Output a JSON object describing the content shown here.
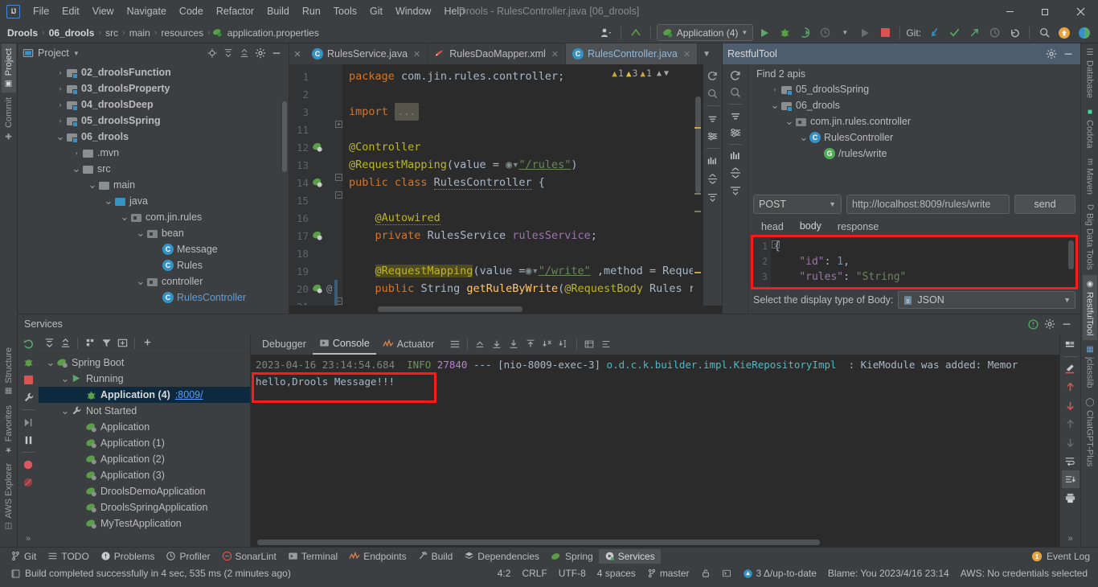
{
  "window": {
    "title": "Drools - RulesController.java [06_drools]",
    "minimize": "—",
    "maximize": "❐",
    "close": "✕"
  },
  "menu": {
    "items": [
      "File",
      "Edit",
      "View",
      "Navigate",
      "Code",
      "Refactor",
      "Build",
      "Run",
      "Tools",
      "Git",
      "Window",
      "Help"
    ]
  },
  "breadcrumb": {
    "items": [
      "Drools",
      "06_drools",
      "src",
      "main",
      "resources",
      "application.properties"
    ],
    "separator": "›"
  },
  "toolbar": {
    "run_config": "Application (4)",
    "git_label": "Git:",
    "icons": [
      "user-avatar-icon",
      "update-project-icon",
      "run-icon",
      "debug-icon",
      "run-with-coverage-icon",
      "profiler-icon",
      "rerun-icon",
      "stop-icon",
      "git-update-icon",
      "git-commit-icon",
      "git-push-icon",
      "git-history-icon",
      "git-rollback-icon",
      "search-everywhere-icon",
      "notifications-icon",
      "ai-assistant-icon"
    ]
  },
  "left_strip": {
    "tabs": [
      "Project",
      "Commit",
      "Structure",
      "Favorites",
      "AWS Explorer"
    ]
  },
  "right_strip": {
    "tabs": [
      "Database",
      "Codota",
      "Maven",
      "Big Data Tools",
      "RestfulTool",
      "jclasslib",
      "ChatGPT-Plus"
    ]
  },
  "project_panel": {
    "title": "Project",
    "dropdown": "▼",
    "actions": [
      "locate-icon",
      "expand-all-icon",
      "collapse-all-icon",
      "settings-icon",
      "hide-icon"
    ],
    "tree": [
      {
        "label": "02_droolsFunction",
        "indent": 1,
        "arrow": "›",
        "icon": "module-icon",
        "bold": true
      },
      {
        "label": "03_droolsProperty",
        "indent": 1,
        "arrow": "›",
        "icon": "module-icon",
        "bold": true
      },
      {
        "label": "04_droolsDeep",
        "indent": 1,
        "arrow": "›",
        "icon": "module-icon",
        "bold": true
      },
      {
        "label": "05_droolsSpring",
        "indent": 1,
        "arrow": "›",
        "icon": "module-icon",
        "bold": true
      },
      {
        "label": "06_drools",
        "indent": 1,
        "arrow": "⌄",
        "icon": "module-icon",
        "bold": true
      },
      {
        "label": ".mvn",
        "indent": 2,
        "arrow": "›",
        "icon": "folder-icon"
      },
      {
        "label": "src",
        "indent": 2,
        "arrow": "⌄",
        "icon": "folder-icon"
      },
      {
        "label": "main",
        "indent": 3,
        "arrow": "⌄",
        "icon": "folder-icon"
      },
      {
        "label": "java",
        "indent": 4,
        "arrow": "⌄",
        "icon": "source-folder-icon"
      },
      {
        "label": "com.jin.rules",
        "indent": 5,
        "arrow": "⌄",
        "icon": "package-icon"
      },
      {
        "label": "bean",
        "indent": 6,
        "arrow": "⌄",
        "icon": "package-icon"
      },
      {
        "label": "Message",
        "indent": 7,
        "arrow": "",
        "icon": "java-class-icon"
      },
      {
        "label": "Rules",
        "indent": 7,
        "arrow": "",
        "icon": "java-class-icon"
      },
      {
        "label": "controller",
        "indent": 6,
        "arrow": "⌄",
        "icon": "package-icon"
      },
      {
        "label": "RulesController",
        "indent": 7,
        "arrow": "",
        "icon": "java-class-icon",
        "blue": true
      }
    ]
  },
  "editor": {
    "tabs": [
      {
        "label": "RulesService.java",
        "icon": "java-class-icon",
        "active": false
      },
      {
        "label": "RulesDaoMapper.xml",
        "icon": "xml-file-icon",
        "active": false
      },
      {
        "label": "RulesController.java",
        "icon": "java-class-icon",
        "active": true
      }
    ],
    "tab_close": "✕",
    "inspections": [
      {
        "icon": "warning-triangle-icon",
        "count": "1"
      },
      {
        "icon": "warning-triangle-icon",
        "count": "3"
      },
      {
        "icon": "warning-triangle-icon",
        "count": "1"
      }
    ],
    "lines": [
      {
        "num": "1",
        "gutter": "",
        "code": "package com.jin.rules.controller;"
      },
      {
        "num": "2",
        "gutter": "",
        "code": ""
      },
      {
        "num": "3",
        "gutter": "",
        "code": "import ..."
      },
      {
        "num": "11",
        "gutter": "",
        "code": ""
      },
      {
        "num": "12",
        "gutter": "spring-bean-icon",
        "code": "@Controller"
      },
      {
        "num": "13",
        "gutter": "",
        "code": "@RequestMapping(value = \"/rules\")"
      },
      {
        "num": "14",
        "gutter": "spring-bean-icon",
        "code": "public class RulesController {"
      },
      {
        "num": "15",
        "gutter": "",
        "code": ""
      },
      {
        "num": "16",
        "gutter": "",
        "code": "    @Autowired"
      },
      {
        "num": "17",
        "gutter": "spring-bean-icon",
        "code": "    private RulesService rulesService;"
      },
      {
        "num": "18",
        "gutter": "",
        "code": ""
      },
      {
        "num": "19",
        "gutter": "",
        "code": "    @RequestMapping(value = \"/write\" ,method = Request"
      },
      {
        "num": "20",
        "gutter": "spring-bean-icon",
        "code": "    public String getRuleByWrite(@RequestBody Rules rul"
      },
      {
        "num": "21",
        "gutter": "",
        "code": ""
      }
    ],
    "fold_placeholder": "...",
    "right_icons": [
      "refresh-icon",
      "search-icon",
      "filter-icon",
      "settings-sliders-icon",
      "chart-icon",
      "expand-icon",
      "collapse-icon"
    ]
  },
  "restful_tool": {
    "title": "RestfulTool",
    "head_actions": [
      "gear-icon",
      "hide-icon"
    ],
    "strip_icons": [
      "refresh-icon",
      "search-icon",
      "filter-icon",
      "settings-sliders-icon",
      "chart-icon",
      "expand-all-icon",
      "collapse-all-icon"
    ],
    "find_text": "Find 2 apis",
    "tree": [
      {
        "label": "05_droolsSpring",
        "indent": 1,
        "arrow": "›",
        "icon": "module-icon"
      },
      {
        "label": "06_drools",
        "indent": 1,
        "arrow": "⌄",
        "icon": "module-icon"
      },
      {
        "label": "com.jin.rules.controller",
        "indent": 2,
        "arrow": "⌄",
        "icon": "package-icon"
      },
      {
        "label": "RulesController",
        "indent": 3,
        "arrow": "⌄",
        "icon": "java-class-icon"
      },
      {
        "label": "/rules/write",
        "indent": 4,
        "arrow": "",
        "icon": "get-mapping-icon"
      }
    ],
    "method": "POST",
    "url": "http://localhost:8009/rules/write",
    "send_label": "send",
    "tabs": [
      {
        "label": "head",
        "active": false
      },
      {
        "label": "body",
        "active": true
      },
      {
        "label": "response",
        "active": false
      }
    ],
    "json_lines": [
      {
        "num": "1",
        "text": "{"
      },
      {
        "num": "2",
        "text": "    \"id\": 1,"
      },
      {
        "num": "3",
        "text": "    \"rules\": \"String\""
      }
    ],
    "footer_label": "Select the display type of Body:",
    "body_type": "JSON",
    "highlight_color": "#ff1a1a"
  },
  "services": {
    "title": "Services",
    "toolbar_icons": [
      "rerun-icon",
      "expand-all-icon",
      "collapse-all-icon",
      "group-icon",
      "filter-icon",
      "add-tab-icon",
      "add-icon"
    ],
    "strip_icons": [
      "rerun-icon",
      "debug-icon",
      "stop-icon",
      "settings-wrench-icon",
      "resume-icon",
      "pause-icon",
      "breakpoint-icon",
      "mute-breakpoints-icon"
    ],
    "tree": [
      {
        "label": "Spring Boot",
        "indent": 0,
        "arrow": "⌄",
        "icon": "spring-boot-icon"
      },
      {
        "label": "Running",
        "indent": 1,
        "arrow": "⌄",
        "icon": "run-icon"
      },
      {
        "label": "Application (4)",
        "indent": 2,
        "arrow": "",
        "icon": "debug-bean-icon",
        "link": ":8009/",
        "selected": true
      },
      {
        "label": "Not Started",
        "indent": 1,
        "arrow": "⌄",
        "icon": "wrench-icon"
      },
      {
        "label": "Application",
        "indent": 2,
        "arrow": "",
        "icon": "spring-boot-icon"
      },
      {
        "label": "Application (1)",
        "indent": 2,
        "arrow": "",
        "icon": "spring-boot-icon"
      },
      {
        "label": "Application (2)",
        "indent": 2,
        "arrow": "",
        "icon": "spring-boot-icon"
      },
      {
        "label": "Application (3)",
        "indent": 2,
        "arrow": "",
        "icon": "spring-boot-icon"
      },
      {
        "label": "DroolsDemoApplication",
        "indent": 2,
        "arrow": "",
        "icon": "spring-boot-icon"
      },
      {
        "label": "DroolsSpringApplication",
        "indent": 2,
        "arrow": "",
        "icon": "spring-boot-icon"
      },
      {
        "label": "MyTestApplication",
        "indent": 2,
        "arrow": "",
        "icon": "spring-boot-icon"
      }
    ],
    "expand_more": "»"
  },
  "console": {
    "tabs": [
      {
        "label": "Debugger",
        "active": false,
        "icon": ""
      },
      {
        "label": "Console",
        "active": true,
        "icon": "console-icon"
      },
      {
        "label": "Actuator",
        "active": false,
        "icon": "actuator-icon"
      }
    ],
    "toolbar_icons": [
      "soft-wrap-icon",
      "up-icon",
      "download-icon",
      "download2-icon",
      "upload-icon",
      "step-out-icon",
      "step-into-icon",
      "table-icon",
      "list-icon"
    ],
    "log": {
      "timestamp": "2023-04-16 23:14:54.684",
      "level": "INFO",
      "pid": "27840",
      "dashes": "---",
      "thread": "[nio-8009-exec-3]",
      "logger": "o.d.c.k.builder.impl.KieRepositoryImpl",
      "colon": ":",
      "message": "KieModule was added: Memor"
    },
    "highlighted_output": "hello,Drools Message!!!",
    "right_icons": [
      "layout-icon",
      "edit-icon",
      "arrow-up-icon",
      "arrow-down-icon",
      "arrow-up-dim-icon",
      "arrow-down-dim-icon",
      "soft-wrap-icon",
      "scroll-end-icon",
      "print-icon"
    ],
    "expand_more": "»"
  },
  "bottom_bar": {
    "items": [
      {
        "label": "Git",
        "icon": "git-icon",
        "active": false
      },
      {
        "label": "TODO",
        "icon": "todo-icon",
        "active": false
      },
      {
        "label": "Problems",
        "icon": "problems-icon",
        "active": false
      },
      {
        "label": "Profiler",
        "icon": "profiler-icon",
        "active": false
      },
      {
        "label": "SonarLint",
        "icon": "sonarlint-icon",
        "active": false
      },
      {
        "label": "Terminal",
        "icon": "terminal-icon",
        "active": false
      },
      {
        "label": "Endpoints",
        "icon": "endpoints-icon",
        "active": false
      },
      {
        "label": "Build",
        "icon": "build-icon",
        "active": false
      },
      {
        "label": "Dependencies",
        "icon": "dependencies-icon",
        "active": false
      },
      {
        "label": "Spring",
        "icon": "spring-icon",
        "active": false
      },
      {
        "label": "Services",
        "icon": "services-icon",
        "active": true
      }
    ],
    "event_log": {
      "label": "Event Log",
      "badge": "1"
    }
  },
  "status_bar": {
    "build_message": "Build completed successfully in 4 sec, 535 ms (2 minutes ago)",
    "caret": "4:2",
    "line_separator": "CRLF",
    "encoding": "UTF-8",
    "indent": "4 spaces",
    "branch": "master",
    "vcs_updates": "3 Δ/up-to-date",
    "blame": "Blame: You 2023/4/16 23:14",
    "aws": "AWS: No credentials selected"
  }
}
